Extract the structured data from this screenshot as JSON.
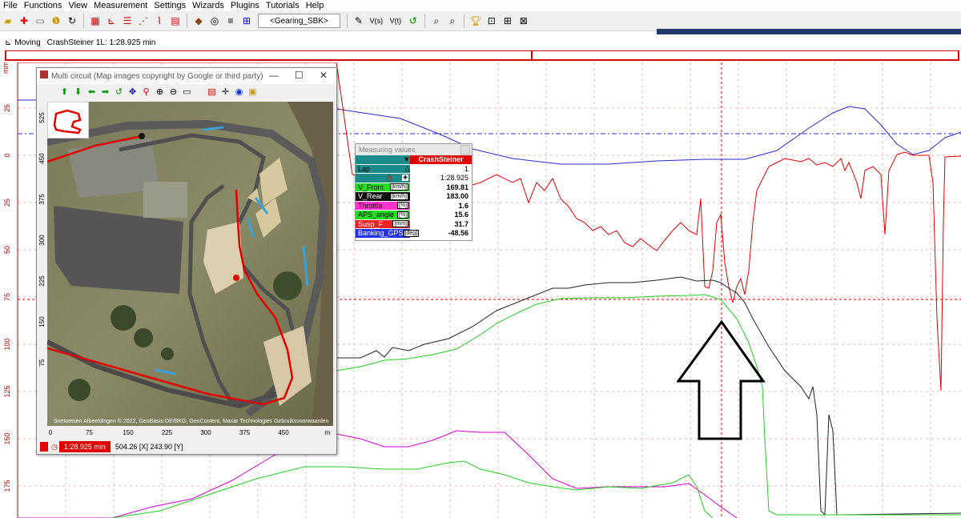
{
  "menu": [
    "File",
    "Functions",
    "View",
    "Measurement",
    "Settings",
    "Wizards",
    "Plugins",
    "Tutorials",
    "Help"
  ],
  "toolbar": {
    "profile_field": "<Gearing_SBK>",
    "vs_label": "V(s)",
    "vt_label": "V(t)"
  },
  "status": {
    "mode": "Moving",
    "session": "CrashSteiner 1L: 1:28.925 min"
  },
  "plot": {
    "y_axis_label": "mm",
    "y_ticks": [
      "25",
      "0",
      "25",
      "50",
      "75",
      "100",
      "125",
      "150",
      "175"
    ],
    "colors": {
      "blue": "#2a2ad0",
      "red": "#e00000",
      "black": "#222222",
      "green": "#22cc22",
      "magenta": "#d000d0"
    }
  },
  "map_window": {
    "title": "Multi circuit   (Map images copyright by Google or third party)",
    "y_ticks": [
      "525",
      "450",
      "375",
      "300",
      "225",
      "150",
      "75"
    ],
    "x_ticks": [
      "0",
      "75",
      "150",
      "225",
      "300",
      "375",
      "450",
      "m"
    ],
    "credit": "Snetoetsen   Afbeeldingen © 2022, GeoBasis-DE/BKG, GeoContent, Maxar Technologies   Gebruiksvoorwaarden",
    "lap_time": "1:28.925 min",
    "coords": "504.26 [X]  243.90 [Y]"
  },
  "measuring_values": {
    "title": "Measuring values",
    "driver": "CrashSteiner",
    "lap_label": "Lap",
    "lap_value": "1",
    "time_value": "1:28.925",
    "rows": [
      {
        "label": "V_Front",
        "unit": "[km/h]",
        "value": "169.81",
        "bg": "#22dd22",
        "fg": "#000"
      },
      {
        "label": "V_Rear",
        "unit": "[km/h]",
        "value": "183.00",
        "bg": "#111111",
        "fg": "#fff"
      },
      {
        "label": "Throttle",
        "unit": "[%]",
        "value": "1.6",
        "bg": "#ff33cc",
        "fg": "#000"
      },
      {
        "label": "APS_angle",
        "unit": "[%]",
        "value": "15.6",
        "bg": "#22dd22",
        "fg": "#000"
      },
      {
        "label": "Susp_F",
        "unit": "[mm]",
        "value": "31.7",
        "bg": "#ee2222",
        "fg": "#fff"
      },
      {
        "label": "Banking_GPS",
        "unit": "[deg]",
        "value": "-48.56",
        "bg": "#2233ee",
        "fg": "#fff"
      }
    ]
  }
}
